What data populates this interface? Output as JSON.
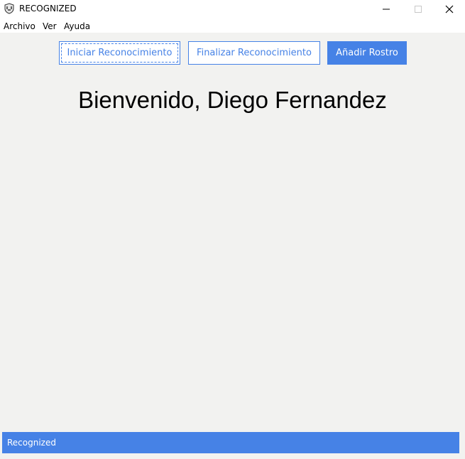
{
  "window": {
    "title": "RECOGNIZED",
    "icon": "shield-logo-icon",
    "controls": [
      "minimize-icon",
      "maximize-icon",
      "close-icon"
    ]
  },
  "menu": {
    "items": [
      "Archivo",
      "Ver",
      "Ayuda"
    ]
  },
  "toolbar": {
    "start_label": "Iniciar Reconocimiento",
    "stop_label": "Finalizar Reconocimiento",
    "add_face_label": "Añadir Rostro"
  },
  "main": {
    "welcome": "Bienvenido, Diego Fernandez"
  },
  "status": {
    "text": "Recognized"
  },
  "colors": {
    "accent": "#4682e6",
    "background": "#f2f2f0"
  }
}
